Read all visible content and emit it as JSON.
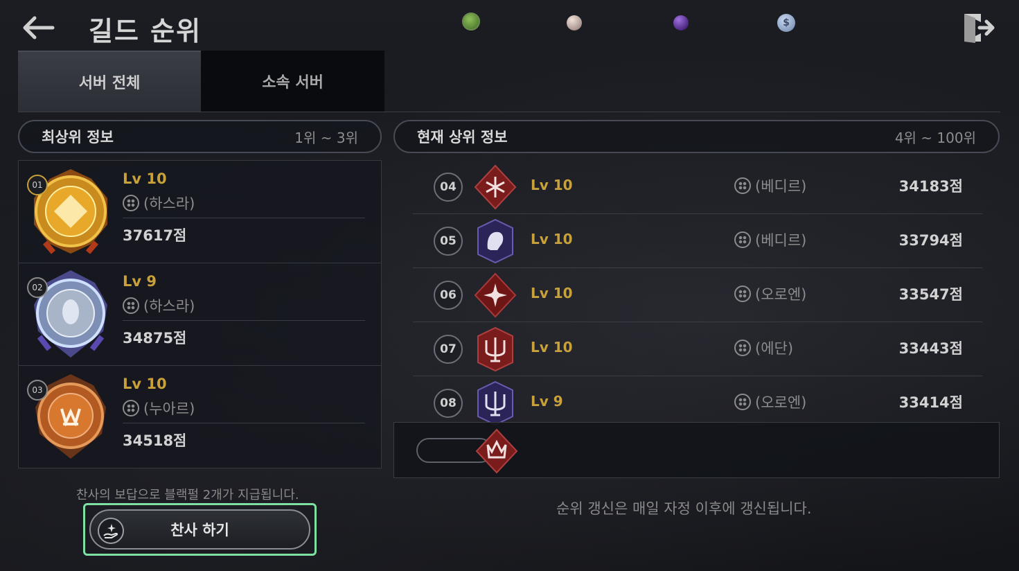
{
  "header": {
    "title": "길드 순위",
    "currencies": [
      {
        "name": "green-coin-icon",
        "color": "#5e8f3a"
      },
      {
        "name": "pearl-icon",
        "color": "#b9a8a0"
      },
      {
        "name": "purple-orb-icon",
        "color": "#5a2a9a"
      },
      {
        "name": "silver-coin-icon",
        "color": "#8fa3c2"
      }
    ]
  },
  "tabs": {
    "all": "서버 전체",
    "affiliated": "소속 서버"
  },
  "top_section": {
    "title": "최상위 정보",
    "range": "1위 ~ 3위"
  },
  "list_section": {
    "title": "현재 상위 정보",
    "range": "4위 ~ 100위"
  },
  "top3": [
    {
      "rank": "01",
      "level": "Lv 10",
      "server": "(하스라)",
      "score": "37617점"
    },
    {
      "rank": "02",
      "level": "Lv 9",
      "server": "(하스라)",
      "score": "34875점"
    },
    {
      "rank": "03",
      "level": "Lv 10",
      "server": "(누아르)",
      "score": "34518점"
    }
  ],
  "ranks": [
    {
      "rank": "04",
      "level": "Lv 10",
      "server": "(베디르)",
      "score": "34183점"
    },
    {
      "rank": "05",
      "level": "Lv 10",
      "server": "(베디르)",
      "score": "33794점"
    },
    {
      "rank": "06",
      "level": "Lv 10",
      "server": "(오로엔)",
      "score": "33547점"
    },
    {
      "rank": "07",
      "level": "Lv 10",
      "server": "(에단)",
      "score": "33443점"
    },
    {
      "rank": "08",
      "level": "Lv 9",
      "server": "(오로엔)",
      "score": "33414점"
    }
  ],
  "cheer": {
    "notice": "찬사의 보답으로 블랙펄 2개가 지급됩니다.",
    "button_label": "찬사 하기"
  },
  "update_notice": "순위 갱신은 매일 자정 이후에 갱신됩니다.",
  "colors": {
    "accent_gold": "#c9a13a",
    "highlight_green": "#7ee0a3"
  }
}
